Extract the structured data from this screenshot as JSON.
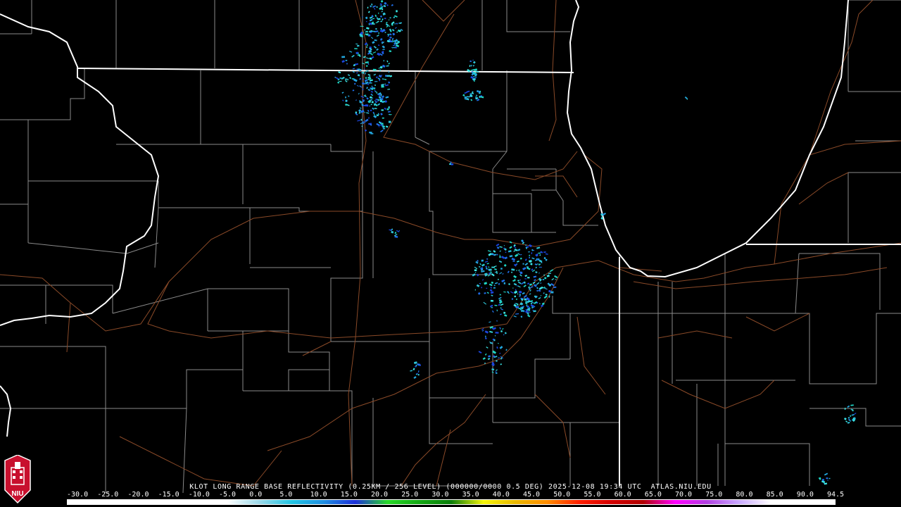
{
  "product": {
    "caption": "KLOT LONG RANGE BASE REFLECTIVITY (0.25KM / 256 LEVEL) (000000/0000 0.5 DEG) 2025-12-08 19:34 UTC  ATLAS.NIU.EDU"
  },
  "legend": {
    "ticks": [
      "-30.0",
      "-25.0",
      "-20.0",
      "-15.0",
      "-10.0",
      "-5.0",
      "0.0",
      "5.0",
      "10.0",
      "15.0",
      "20.0",
      "25.0",
      "30.0",
      "35.0",
      "40.0",
      "45.0",
      "50.0",
      "55.0",
      "60.0",
      "65.0",
      "70.0",
      "75.0",
      "80.0",
      "85.0",
      "90.0",
      "94.5"
    ],
    "colors": [
      "#ffffff",
      "#ffffff",
      "#ffffff",
      "#ffffff",
      "#ffffff",
      "#ffffff",
      "#9bd8e8",
      "#22c4e2",
      "#1f8fe0",
      "#1c2fd9",
      "#28d828",
      "#14a814",
      "#0a7d0a",
      "#f5f50a",
      "#e8b800",
      "#ff8c00",
      "#ff1e00",
      "#d40000",
      "#b00000",
      "#ff00ff",
      "#b040e0",
      "#c8a8ff",
      "#ffffff",
      "#ffffff",
      "#ffffff"
    ]
  },
  "logo": {
    "text": "NIU",
    "colors": {
      "red": "#c8102e",
      "white": "#ffffff"
    }
  },
  "map_colors": {
    "state_border": "#ffffff",
    "county": "#8a8a8a",
    "road": "#8a4a28",
    "lake_shore": "#ffffff"
  },
  "echo_colors": [
    "#2ec4d8",
    "#22a8e0",
    "#1fd6c6",
    "#1f6ee8",
    "#3be8e8",
    "#1b46e0"
  ]
}
